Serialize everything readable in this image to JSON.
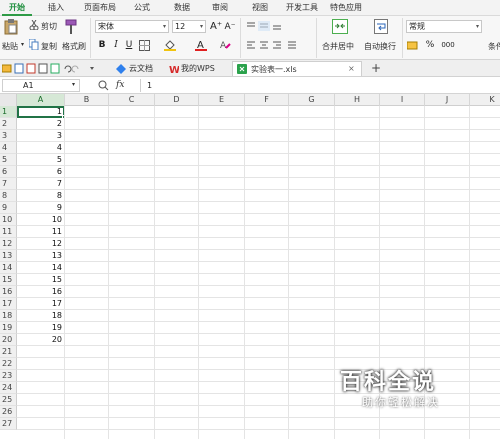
{
  "ribbon_tabs": [
    "开始",
    "插入",
    "页面布局",
    "公式",
    "数据",
    "审阅",
    "视图",
    "开发工具",
    "特色应用"
  ],
  "clipboard": {
    "paste": "粘贴",
    "cut": "剪切",
    "copy": "复制",
    "format_painter": "格式刷"
  },
  "font": {
    "name": "宋体",
    "size": "12",
    "bold": "B",
    "italic": "I",
    "underline": "U",
    "grow": "A⁺",
    "shrink": "A⁻"
  },
  "alignment": {
    "merge_center": "合并居中",
    "wrap_text": "自动换行"
  },
  "number": {
    "format": "常规",
    "percent": "%",
    "thousands": "000"
  },
  "overflow_label": "条件",
  "doc_tabs": [
    {
      "label": "云文档"
    },
    {
      "label": "我的WPS"
    },
    {
      "label": "实验表一.xls",
      "close": "×"
    }
  ],
  "new_tab": "+",
  "formula_bar": {
    "cell_ref": "A1",
    "fx": "fx",
    "value": "1"
  },
  "sheet": {
    "columns": [
      "A",
      "B",
      "C",
      "D",
      "E",
      "F",
      "G",
      "H",
      "I",
      "J",
      "K"
    ],
    "rows": [
      "1",
      "2",
      "3",
      "4",
      "5",
      "6",
      "7",
      "8",
      "9",
      "10",
      "11",
      "12",
      "13",
      "14",
      "15",
      "16",
      "17",
      "18",
      "19",
      "20",
      "21",
      "22",
      "23",
      "24",
      "25",
      "26",
      "27"
    ],
    "colA_values": [
      "1",
      "2",
      "3",
      "4",
      "5",
      "6",
      "7",
      "8",
      "9",
      "10",
      "11",
      "12",
      "13",
      "14",
      "15",
      "16",
      "17",
      "18",
      "19",
      "20"
    ],
    "selected_cell": "A1",
    "accent": "#217346"
  },
  "watermark": {
    "title": "百科全说",
    "subtitle": "助你轻松解决"
  }
}
